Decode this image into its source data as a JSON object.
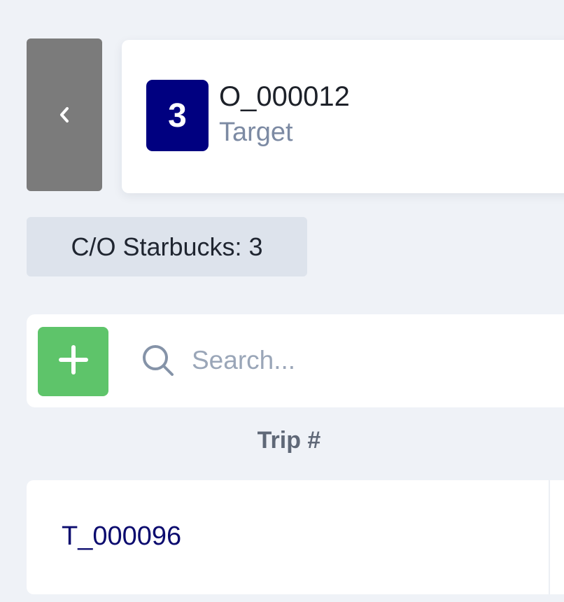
{
  "header": {
    "back_icon": "chevron-left-icon",
    "badge_number": "3",
    "badge_color": "#000080",
    "order_id": "O_000012",
    "subtitle": "Target"
  },
  "chip": {
    "label": "C/O Starbucks: 3"
  },
  "toolbar": {
    "add_icon": "plus-icon",
    "add_color": "#5ec46a",
    "search_icon": "search-icon",
    "search_placeholder": "Search...",
    "search_value": ""
  },
  "table": {
    "columns": [
      "Trip #"
    ],
    "rows": [
      {
        "trip": "T_000096"
      }
    ]
  }
}
